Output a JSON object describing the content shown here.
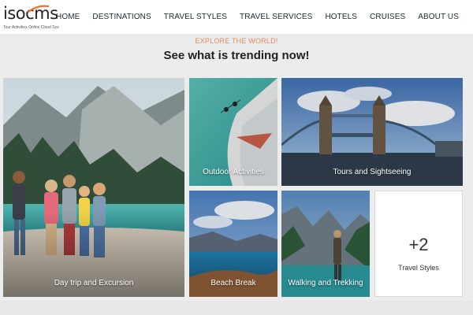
{
  "brand": {
    "name": "isocms",
    "tagline": "Tour Activities Online Cloud Sys"
  },
  "nav": [
    {
      "label": "HOME"
    },
    {
      "label": "DESTINATIONS"
    },
    {
      "label": "TRAVEL STYLES"
    },
    {
      "label": "TRAVEL SERVICES"
    },
    {
      "label": "HOTELS"
    },
    {
      "label": "CRUISES"
    },
    {
      "label": "ABOUT US"
    }
  ],
  "section": {
    "eyebrow": "EXPLORE THE WORLD!",
    "title": "See what is trending now!"
  },
  "tiles": [
    {
      "label": "Day trip and Excursion"
    },
    {
      "label": "Outdoor Activities"
    },
    {
      "label": "Tours and Sightseeing"
    },
    {
      "label": "Beach Break"
    },
    {
      "label": "Walking and Trekking"
    }
  ],
  "more": {
    "count": "+2",
    "label": "Travel Styles"
  },
  "colors": {
    "accent": "#e08a5b",
    "nav_text": "#1f2a2e",
    "background": "#ececec"
  }
}
